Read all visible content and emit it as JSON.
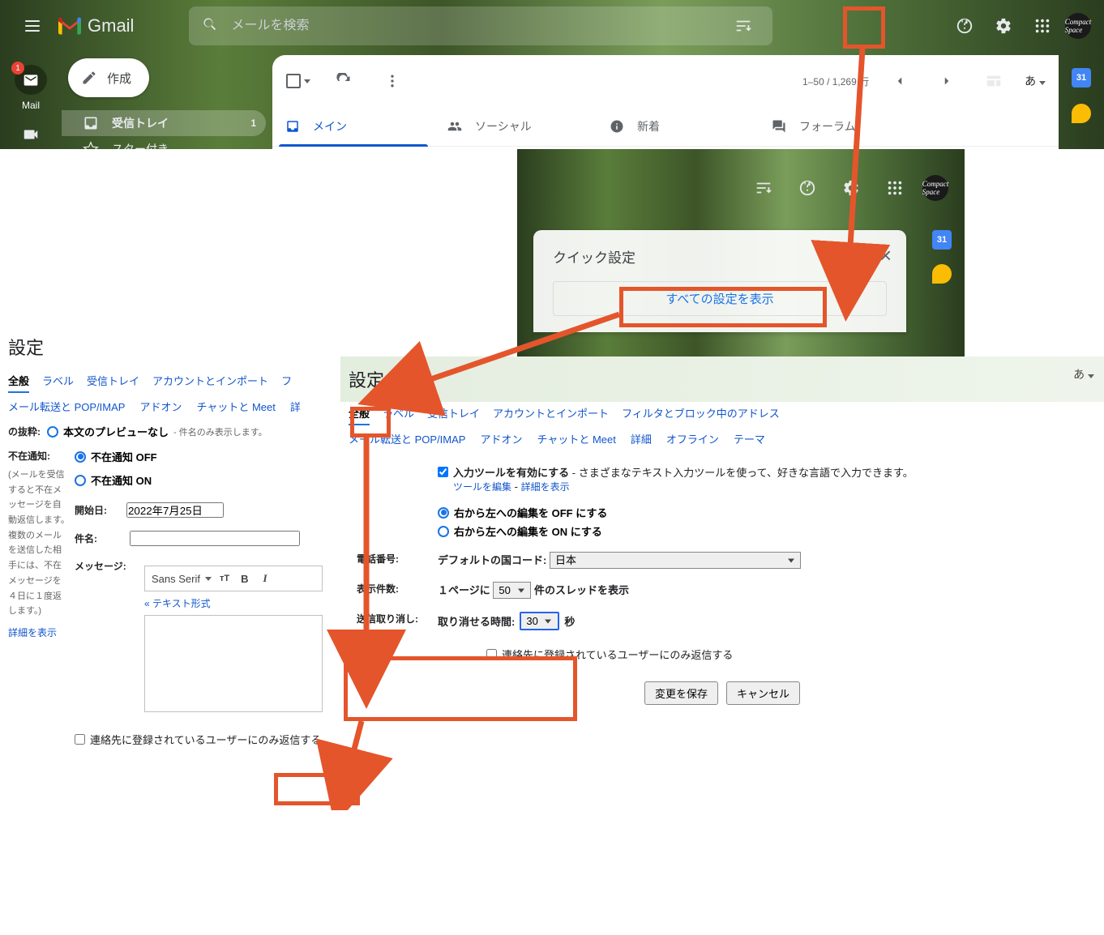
{
  "header": {
    "product": "Gmail",
    "search_placeholder": "メールを検索",
    "mail_label": "Mail",
    "mail_badge": "1",
    "avatar_text": "Compact Space"
  },
  "compose": {
    "label": "作成"
  },
  "sidebar": {
    "items": [
      {
        "label": "受信トレイ",
        "count": "1"
      },
      {
        "label": "スター付き",
        "count": ""
      }
    ]
  },
  "toolbar": {
    "pager": "1–50 / 1,269 行",
    "lang": "あ"
  },
  "tabs": [
    {
      "label": "メイン"
    },
    {
      "label": "ソーシャル"
    },
    {
      "label": "新着"
    },
    {
      "label": "フォーラム"
    }
  ],
  "rightrail": {
    "calendar": "31"
  },
  "panel2": {
    "title": "クイック設定",
    "all_settings": "すべての設定を表示",
    "calendar": "31"
  },
  "panel3": {
    "title": "設定",
    "tabs": [
      "全般",
      "ラベル",
      "受信トレイ",
      "アカウントとインポート",
      "フ"
    ],
    "subtabs": [
      "メール転送と POP/IMAP",
      "アドオン",
      "チャットと Meet",
      "詳"
    ],
    "excerpt_label": "の抜粋:",
    "excerpt_option": "本文のプレビューなし",
    "excerpt_note": " - 件名のみ表示します。",
    "vacation_label": "不在通知:",
    "vacation_help": "(メールを受信すると不在メッセージを自動返信します。複数のメールを送信した相手には、不在メッセージを４日に１度返します。)",
    "vac_off": "不在通知 OFF",
    "vac_on": "不在通知 ON",
    "start_label": "開始日:",
    "start_value": "2022年7月25日",
    "subject_label": "件名:",
    "message_label": "メッセージ:",
    "font_name": "Sans Serif",
    "text_mode": "« テキスト形式",
    "show_more": "詳細を表示",
    "contacts_only": "連絡先に登録されているユーザーにのみ返信する"
  },
  "panel4": {
    "title": "設定",
    "tabs": [
      "全般",
      "ラベル",
      "受信トレイ",
      "アカウントとインポート",
      "フィルタとブロック中のアドレス"
    ],
    "subtabs": [
      "メール転送と POP/IMAP",
      "アドオン",
      "チャットと Meet",
      "詳細",
      "オフライン",
      "テーマ"
    ],
    "lang_corner": "あ",
    "input_tool_label": "入力ツールを有効にする",
    "input_tool_desc": " - さまざまなテキスト入力ツールを使って、好きな言語で入力できます。",
    "edit_tool": "ツールを編集",
    "more_info": "詳細を表示",
    "rtl_off": "右から左への編集を OFF にする",
    "rtl_on": "右から左への編集を ON にする",
    "phone_label": "電話番号:",
    "phone_field": "デフォルトの国コード:",
    "country": "日本",
    "pagesize_label": "表示件数:",
    "pagesize_pre": "１ページに",
    "pagesize_val": "50",
    "pagesize_post": "件のスレッドを表示",
    "undo_label": "送信取り消し:",
    "undo_field": "取り消せる時間:",
    "undo_val": "30",
    "undo_unit": "秒",
    "contacts_only": "連絡先に登録されているユーザーにのみ返信する",
    "save": "変更を保存",
    "cancel": "キャンセル"
  }
}
